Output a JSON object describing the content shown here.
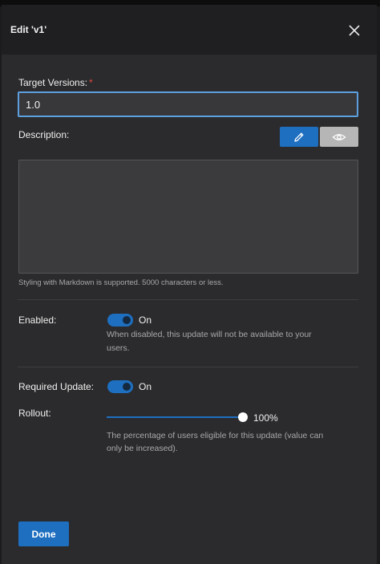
{
  "dialog": {
    "title": "Edit 'v1'",
    "close_icon": "close-icon"
  },
  "target_versions": {
    "label": "Target Versions:",
    "required_mark": "*",
    "value": "1.0"
  },
  "description": {
    "label": "Description:",
    "edit_icon": "pencil-icon",
    "preview_icon": "eye-icon",
    "value": "",
    "help": "Styling with Markdown is supported. 5000 characters or less."
  },
  "enabled": {
    "label": "Enabled:",
    "state_text": "On",
    "on": true,
    "help_line1": "When disabled, this update will not be available to your",
    "help_line2": "users."
  },
  "required_update": {
    "label": "Required Update:",
    "state_text": "On",
    "on": true
  },
  "rollout": {
    "label": "Rollout:",
    "value_text": "100%",
    "fraction": 1.0,
    "help_line1": "The percentage of users eligible for this update (value can",
    "help_line2": "only be increased)."
  },
  "footer": {
    "done_label": "Done"
  },
  "colors": {
    "accent": "#1e6fc0",
    "focus_border": "#5da0e0",
    "required": "#e0483f"
  }
}
